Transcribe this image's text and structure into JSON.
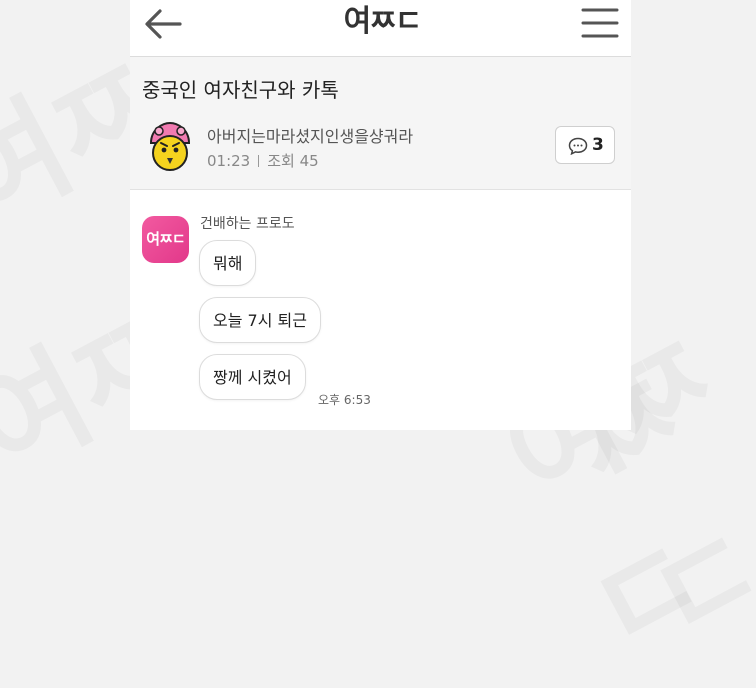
{
  "header": {
    "logo_text": "여ㅉㄷ"
  },
  "post": {
    "title": "중국인 여자친구와 카톡",
    "author": "아버지는마라셨지인생을샹궈라",
    "time": "01:23",
    "views_label": "조회",
    "views": "45",
    "comment_count": "3"
  },
  "chat": {
    "avatar_text": "여ㅉㄷ",
    "sender": "건배하는 프로도",
    "messages": [
      {
        "text": "뭐해"
      },
      {
        "text": "오늘 7시 퇴근"
      },
      {
        "text": "짱께 시켰어"
      }
    ],
    "time": "오후 6:53"
  },
  "colors": {
    "accent_pink": "#e94792",
    "avatar_yellow": "#f5d31e",
    "avatar_pink": "#f07ab0"
  }
}
